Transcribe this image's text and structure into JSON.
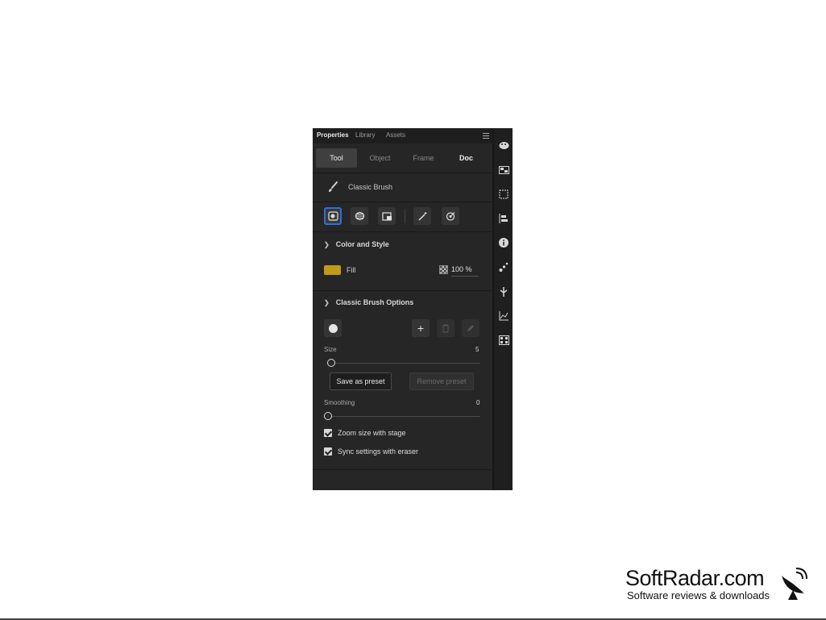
{
  "panel": {
    "tabs": [
      "Properties",
      "Library",
      "Assets"
    ],
    "segments": [
      "Tool",
      "Object",
      "Frame",
      "Doc"
    ],
    "tool_name": "Classic Brush",
    "color_section": {
      "title": "Color and Style",
      "fill_label": "Fill",
      "fill_color": "#c29a17",
      "opacity": "100 %"
    },
    "brush_section": {
      "title": "Classic Brush Options",
      "size_label": "Size",
      "size_value": "5",
      "save_preset": "Save as preset",
      "remove_preset": "Remove preset",
      "smoothing_label": "Smoothing",
      "smoothing_value": "0",
      "zoom_checkbox": "Zoom size with stage",
      "sync_checkbox": "Sync settings with eraser"
    }
  },
  "watermark": {
    "title": "SoftRadar.com",
    "subtitle": "Software reviews & downloads"
  }
}
